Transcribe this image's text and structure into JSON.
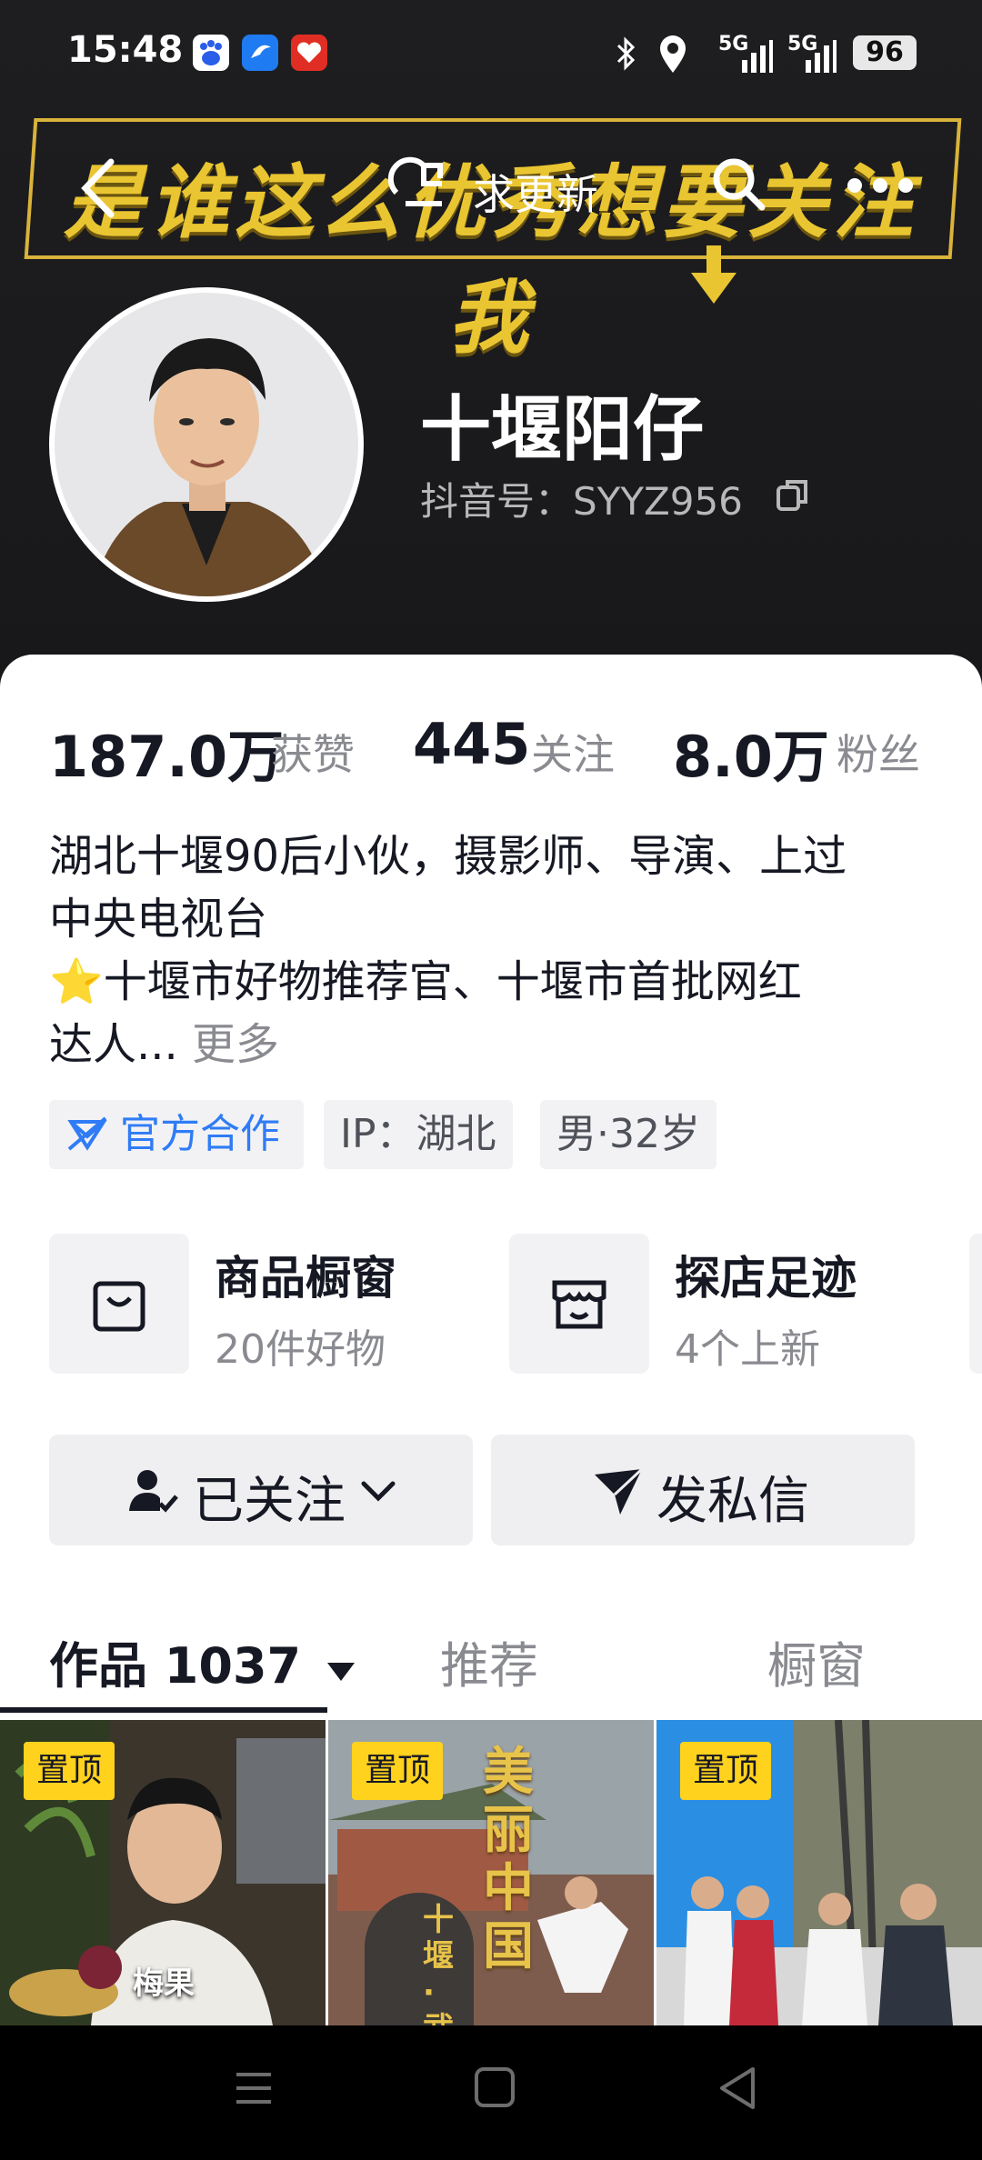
{
  "status_bar": {
    "time": "15:48",
    "network_1": "5G",
    "network_2": "5G",
    "battery": "96"
  },
  "banner": {
    "text": "是谁这么优秀想要关注我"
  },
  "top_nav": {
    "update_label": "求更新"
  },
  "profile": {
    "name": "十堰阳仔",
    "douyin_id": "抖音号：SYYZ956"
  },
  "stats": [
    {
      "value": "187.0万",
      "label": "获赞"
    },
    {
      "value": "445",
      "label": "关注"
    },
    {
      "value": "8.0万",
      "label": "粉丝"
    }
  ],
  "bio": {
    "line1": "湖北十堰90后小伙，摄影师、导演、上过",
    "line2": "中央电视台",
    "line3": "⭐十堰市好物推荐官、十堰市首批网红",
    "line4": "达人...",
    "more": "更多"
  },
  "tags": {
    "official": "官方合作",
    "ip": "IP：湖北",
    "gender_age": "男·32岁"
  },
  "services": [
    {
      "title": "商品橱窗",
      "subtitle": "20件好物"
    },
    {
      "title": "探店足迹",
      "subtitle": "4个上新"
    }
  ],
  "actions": {
    "followed": "已关注",
    "message": "发私信"
  },
  "tabs": {
    "works": "作品 1037",
    "recommend": "推荐",
    "shop": "橱窗"
  },
  "thumbnails": [
    {
      "pin": "置顶",
      "caption": "梅果"
    },
    {
      "pin": "置顶",
      "vertical_text": "美丽中国",
      "side_text": "十堰·武"
    },
    {
      "pin": "置顶"
    }
  ],
  "colors": {
    "accent_yellow": "#ffd21e",
    "link_blue": "#2f7cf6",
    "text_dark": "#161823",
    "text_gray": "#8a8b91"
  }
}
